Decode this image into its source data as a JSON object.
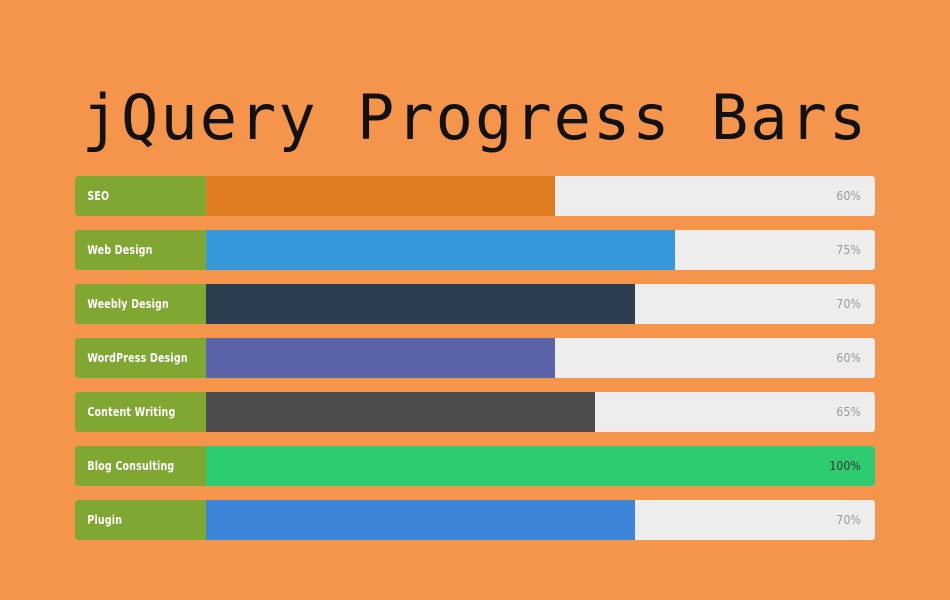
{
  "header": {
    "title": "jQuery Progress Bars"
  },
  "theme": {
    "background": "#f4954b",
    "label_background": "#7fa732",
    "label_text": "#ffffff",
    "track": "#ededed",
    "percent_text": "#9a9a9a",
    "title_text": "#111111"
  },
  "chart_data": {
    "type": "bar",
    "title": "jQuery Progress Bars",
    "xlabel": "",
    "ylabel": "",
    "xlim": [
      0,
      100
    ],
    "orientation": "horizontal",
    "grid": false,
    "legend": "none",
    "unit": "%",
    "categories": [
      "SEO",
      "Web Design",
      "Weebly Design",
      "WordPress Design",
      "Content Writing",
      "Blog Consulting",
      "Plugin"
    ],
    "values": [
      60,
      75,
      70,
      60,
      65,
      100,
      70
    ],
    "value_labels": [
      "60%",
      "75%",
      "70%",
      "60%",
      "65%",
      "100%",
      "70%"
    ],
    "colors": [
      "#e07d22",
      "#3498db",
      "#2c3e50",
      "#5b64a8",
      "#4d4d4d",
      "#2ecc71",
      "#3c85d8"
    ]
  },
  "bars": [
    {
      "label": "SEO",
      "percent": 60,
      "percent_label": "60%",
      "color": "#e07d22",
      "percent_on_fill": false
    },
    {
      "label": "Web Design",
      "percent": 75,
      "percent_label": "75%",
      "color": "#3498db",
      "percent_on_fill": false
    },
    {
      "label": "Weebly Design",
      "percent": 70,
      "percent_label": "70%",
      "color": "#2c3e50",
      "percent_on_fill": false
    },
    {
      "label": "WordPress Design",
      "percent": 60,
      "percent_label": "60%",
      "color": "#5b64a8",
      "percent_on_fill": false
    },
    {
      "label": "Content Writing",
      "percent": 65,
      "percent_label": "65%",
      "color": "#4d4d4d",
      "percent_on_fill": false
    },
    {
      "label": "Blog Consulting",
      "percent": 100,
      "percent_label": "100%",
      "color": "#2ecc71",
      "percent_on_fill": true
    },
    {
      "label": "Plugin",
      "percent": 70,
      "percent_label": "70%",
      "color": "#3c85d8",
      "percent_on_fill": false
    }
  ]
}
